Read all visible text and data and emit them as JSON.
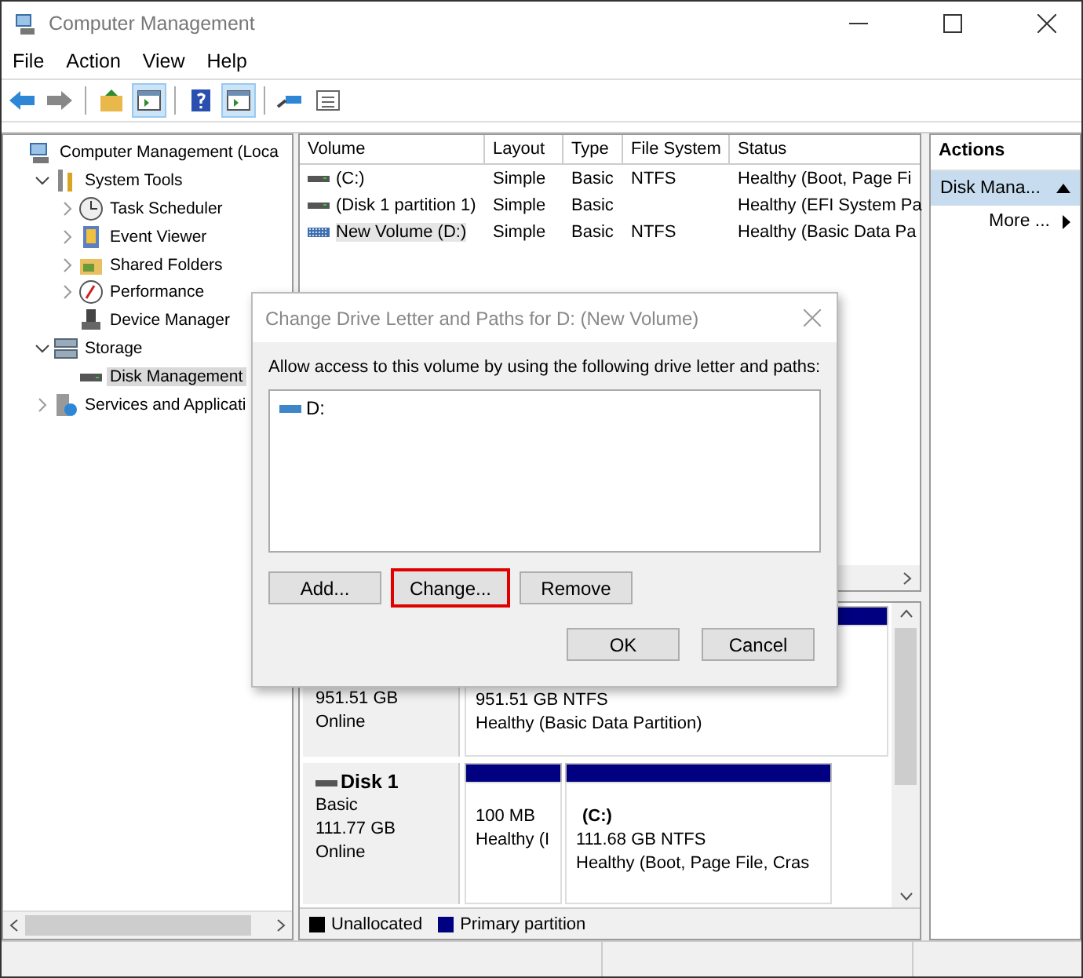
{
  "window": {
    "title": "Computer Management"
  },
  "menu": [
    "File",
    "Action",
    "View",
    "Help"
  ],
  "toolbar": [
    [
      {
        "kind": "back",
        "pressed": false
      },
      {
        "kind": "forward",
        "pressed": false
      }
    ],
    [
      {
        "kind": "up",
        "pressed": false
      },
      {
        "kind": "tree",
        "pressed": true
      }
    ],
    [
      {
        "kind": "help",
        "pressed": false
      },
      {
        "kind": "pane",
        "pressed": true
      }
    ],
    [
      {
        "kind": "connect",
        "pressed": false
      },
      {
        "kind": "list",
        "pressed": false
      }
    ]
  ],
  "tree": [
    {
      "label": "Computer Management (Loca",
      "selected": false,
      "children": [
        {
          "label": "System Tools",
          "expanded": true,
          "selected": false,
          "children": [
            {
              "label": "Task Scheduler",
              "expanded": false,
              "selected": false
            },
            {
              "label": "Event Viewer",
              "expanded": false,
              "selected": false
            },
            {
              "label": "Shared Folders",
              "expanded": false,
              "selected": false
            },
            {
              "label": "Performance",
              "expanded": false,
              "selected": false
            },
            {
              "label": "Device Manager",
              "selected": false
            }
          ]
        },
        {
          "label": "Storage",
          "expanded": true,
          "selected": false,
          "children": [
            {
              "label": "Disk Management",
              "selected": true
            }
          ]
        },
        {
          "label": "Services and Applicati",
          "expanded": false,
          "selected": false
        }
      ]
    }
  ],
  "table": {
    "columns": [
      "Volume",
      "Layout",
      "Type",
      "File System",
      "Status"
    ],
    "rows": [
      {
        "kind": "plain",
        "selected": false,
        "cells": [
          "(C:)",
          "Simple",
          "Basic",
          "NTFS",
          "Healthy (Boot, Page Fi"
        ]
      },
      {
        "kind": "plain",
        "selected": false,
        "cells": [
          "(Disk 1 partition 1)",
          "Simple",
          "Basic",
          "",
          "Healthy (EFI System Pa"
        ]
      },
      {
        "kind": "hatched",
        "selected": true,
        "cells": [
          "New Volume (D:)",
          "Simple",
          "Basic",
          "NTFS",
          "Healthy (Basic Data Pa"
        ]
      }
    ]
  },
  "disks": [
    {
      "lines": [
        "951.51 GB",
        "Online"
      ],
      "partitions": [
        {
          "lines": [
            "951.51 GB NTFS",
            "Healthy (Basic Data Partition)"
          ]
        }
      ]
    },
    {
      "name": "Disk 1",
      "lines": [
        "Basic",
        "111.77 GB",
        "Online"
      ],
      "partitions": [
        {
          "lines": [
            "100 MB",
            "Healthy (I"
          ]
        },
        {
          "title": "(C:)",
          "lines": [
            "111.68 GB NTFS",
            "Healthy (Boot, Page File, Cras"
          ]
        }
      ]
    }
  ],
  "legend": [
    {
      "label": "Unallocated",
      "color": "#000000"
    },
    {
      "label": "Primary partition",
      "color": "#000080"
    }
  ],
  "actions": {
    "header": "Actions",
    "section": "Disk Mana...",
    "items": [
      "More ..."
    ]
  },
  "dialog": {
    "title": "Change Drive Letter and Paths for D: (New Volume)",
    "prompt": "Allow access to this volume by using the following drive letter and paths:",
    "paths": [
      "D:"
    ],
    "buttons": [
      {
        "label": "Add...",
        "highlighted": false
      },
      {
        "label": "Change...",
        "highlighted": true
      },
      {
        "label": "Remove",
        "highlighted": false
      }
    ],
    "footer": [
      "OK",
      "Cancel"
    ]
  }
}
